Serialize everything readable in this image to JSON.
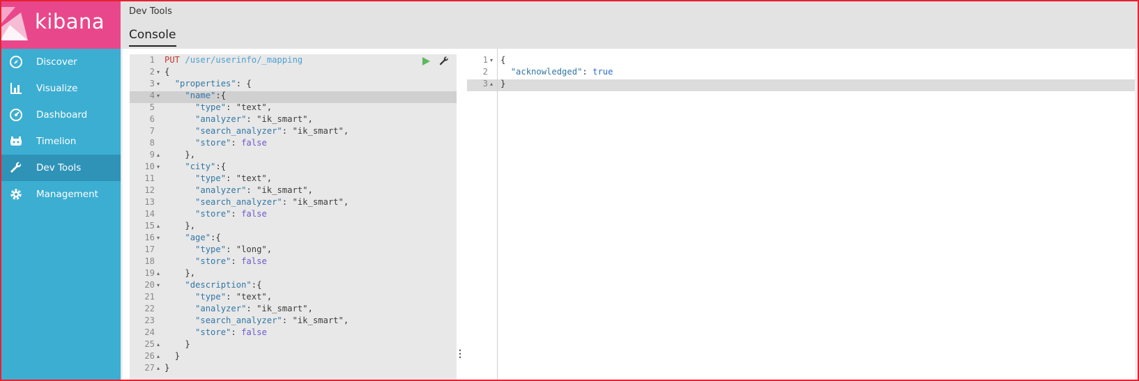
{
  "app": {
    "logo_text": "kibana"
  },
  "sidebar": {
    "items": [
      {
        "label": "Discover",
        "icon": "compass-icon"
      },
      {
        "label": "Visualize",
        "icon": "bar-chart-icon"
      },
      {
        "label": "Dashboard",
        "icon": "dashboard-icon"
      },
      {
        "label": "Timelion",
        "icon": "timelion-icon"
      },
      {
        "label": "Dev Tools",
        "icon": "wrench-icon",
        "active": true
      },
      {
        "label": "Management",
        "icon": "gear-icon"
      }
    ]
  },
  "header": {
    "breadcrumb": "Dev Tools",
    "tab": "Console"
  },
  "request": {
    "method": "PUT",
    "path": "/user/userinfo/_mapping",
    "line_numbers": [
      "1",
      "2",
      "3",
      "4",
      "5",
      "6",
      "7",
      "8",
      "9",
      "10",
      "11",
      "12",
      "13",
      "14",
      "15",
      "16",
      "17",
      "18",
      "19",
      "20",
      "21",
      "22",
      "23",
      "24",
      "25",
      "26",
      "27"
    ],
    "active_line": 4
  },
  "response": {
    "line_numbers": [
      "1",
      "2",
      "3"
    ],
    "key": "\"acknowledged\"",
    "value": "true"
  },
  "colors": {
    "sidebar": "#3caed2",
    "logo_bg": "#e8488b",
    "active_nav": "#2f93b8",
    "header": "#e3e3e3",
    "method": "#c0392b",
    "run_icon": "#5cb85c"
  }
}
